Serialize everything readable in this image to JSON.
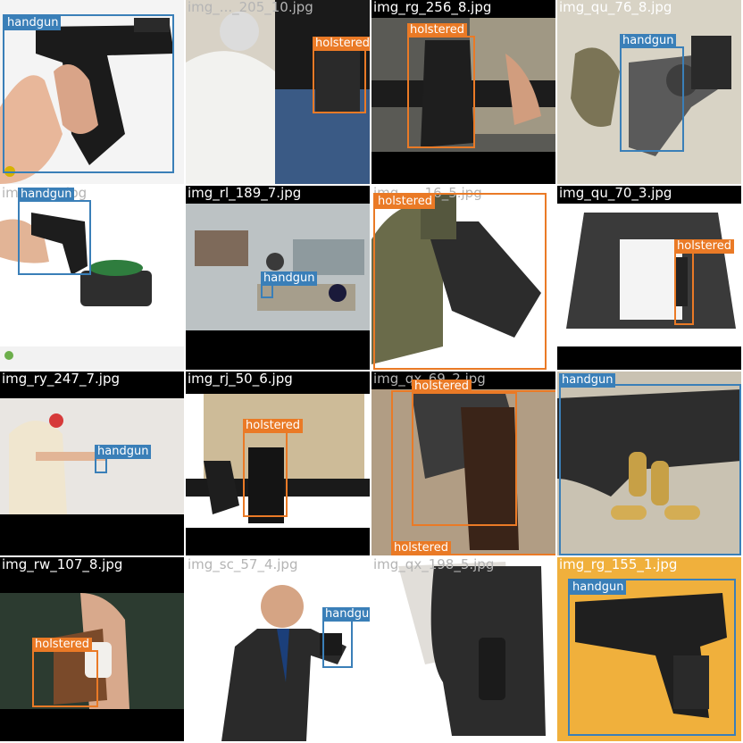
{
  "colors": {
    "handgun": "#3a7fb8",
    "holstered": "#ea7a26"
  },
  "tiles": [
    {
      "filename": "",
      "labels": [
        "handgun"
      ]
    },
    {
      "filename": "img_..._205_10.jpg",
      "labels": [
        "holstered"
      ]
    },
    {
      "filename": "img_rg_256_8.jpg",
      "labels": [
        "holstered"
      ]
    },
    {
      "filename": "img_qu_76_8.jpg",
      "labels": [
        "handgun"
      ]
    },
    {
      "filename": "img_..._3.jpg",
      "labels": [
        "handgun"
      ]
    },
    {
      "filename": "img_rl_189_7.jpg",
      "labels": [
        "handgun"
      ]
    },
    {
      "filename": "img_..._16_5.jpg",
      "labels": [
        "holstered"
      ]
    },
    {
      "filename": "img_qu_70_3.jpg",
      "labels": [
        "holstered"
      ]
    },
    {
      "filename": "img_ry_247_7.jpg",
      "labels": [
        "handgun"
      ]
    },
    {
      "filename": "img_rj_50_6.jpg",
      "labels": [
        "holstered"
      ]
    },
    {
      "filename": "img_qx_69_2.jpg",
      "labels": [
        "holstered",
        "holstered"
      ]
    },
    {
      "filename": "",
      "labels": [
        "handgun"
      ]
    },
    {
      "filename": "img_rw_107_8.jpg",
      "labels": [
        "holstered"
      ]
    },
    {
      "filename": "img_sc_57_4.jpg",
      "labels": [
        "handgun"
      ]
    },
    {
      "filename": "img_qx_198_5.jpg",
      "labels": []
    },
    {
      "filename": "img_rg_155_1.jpg",
      "labels": [
        "handgun"
      ]
    }
  ]
}
